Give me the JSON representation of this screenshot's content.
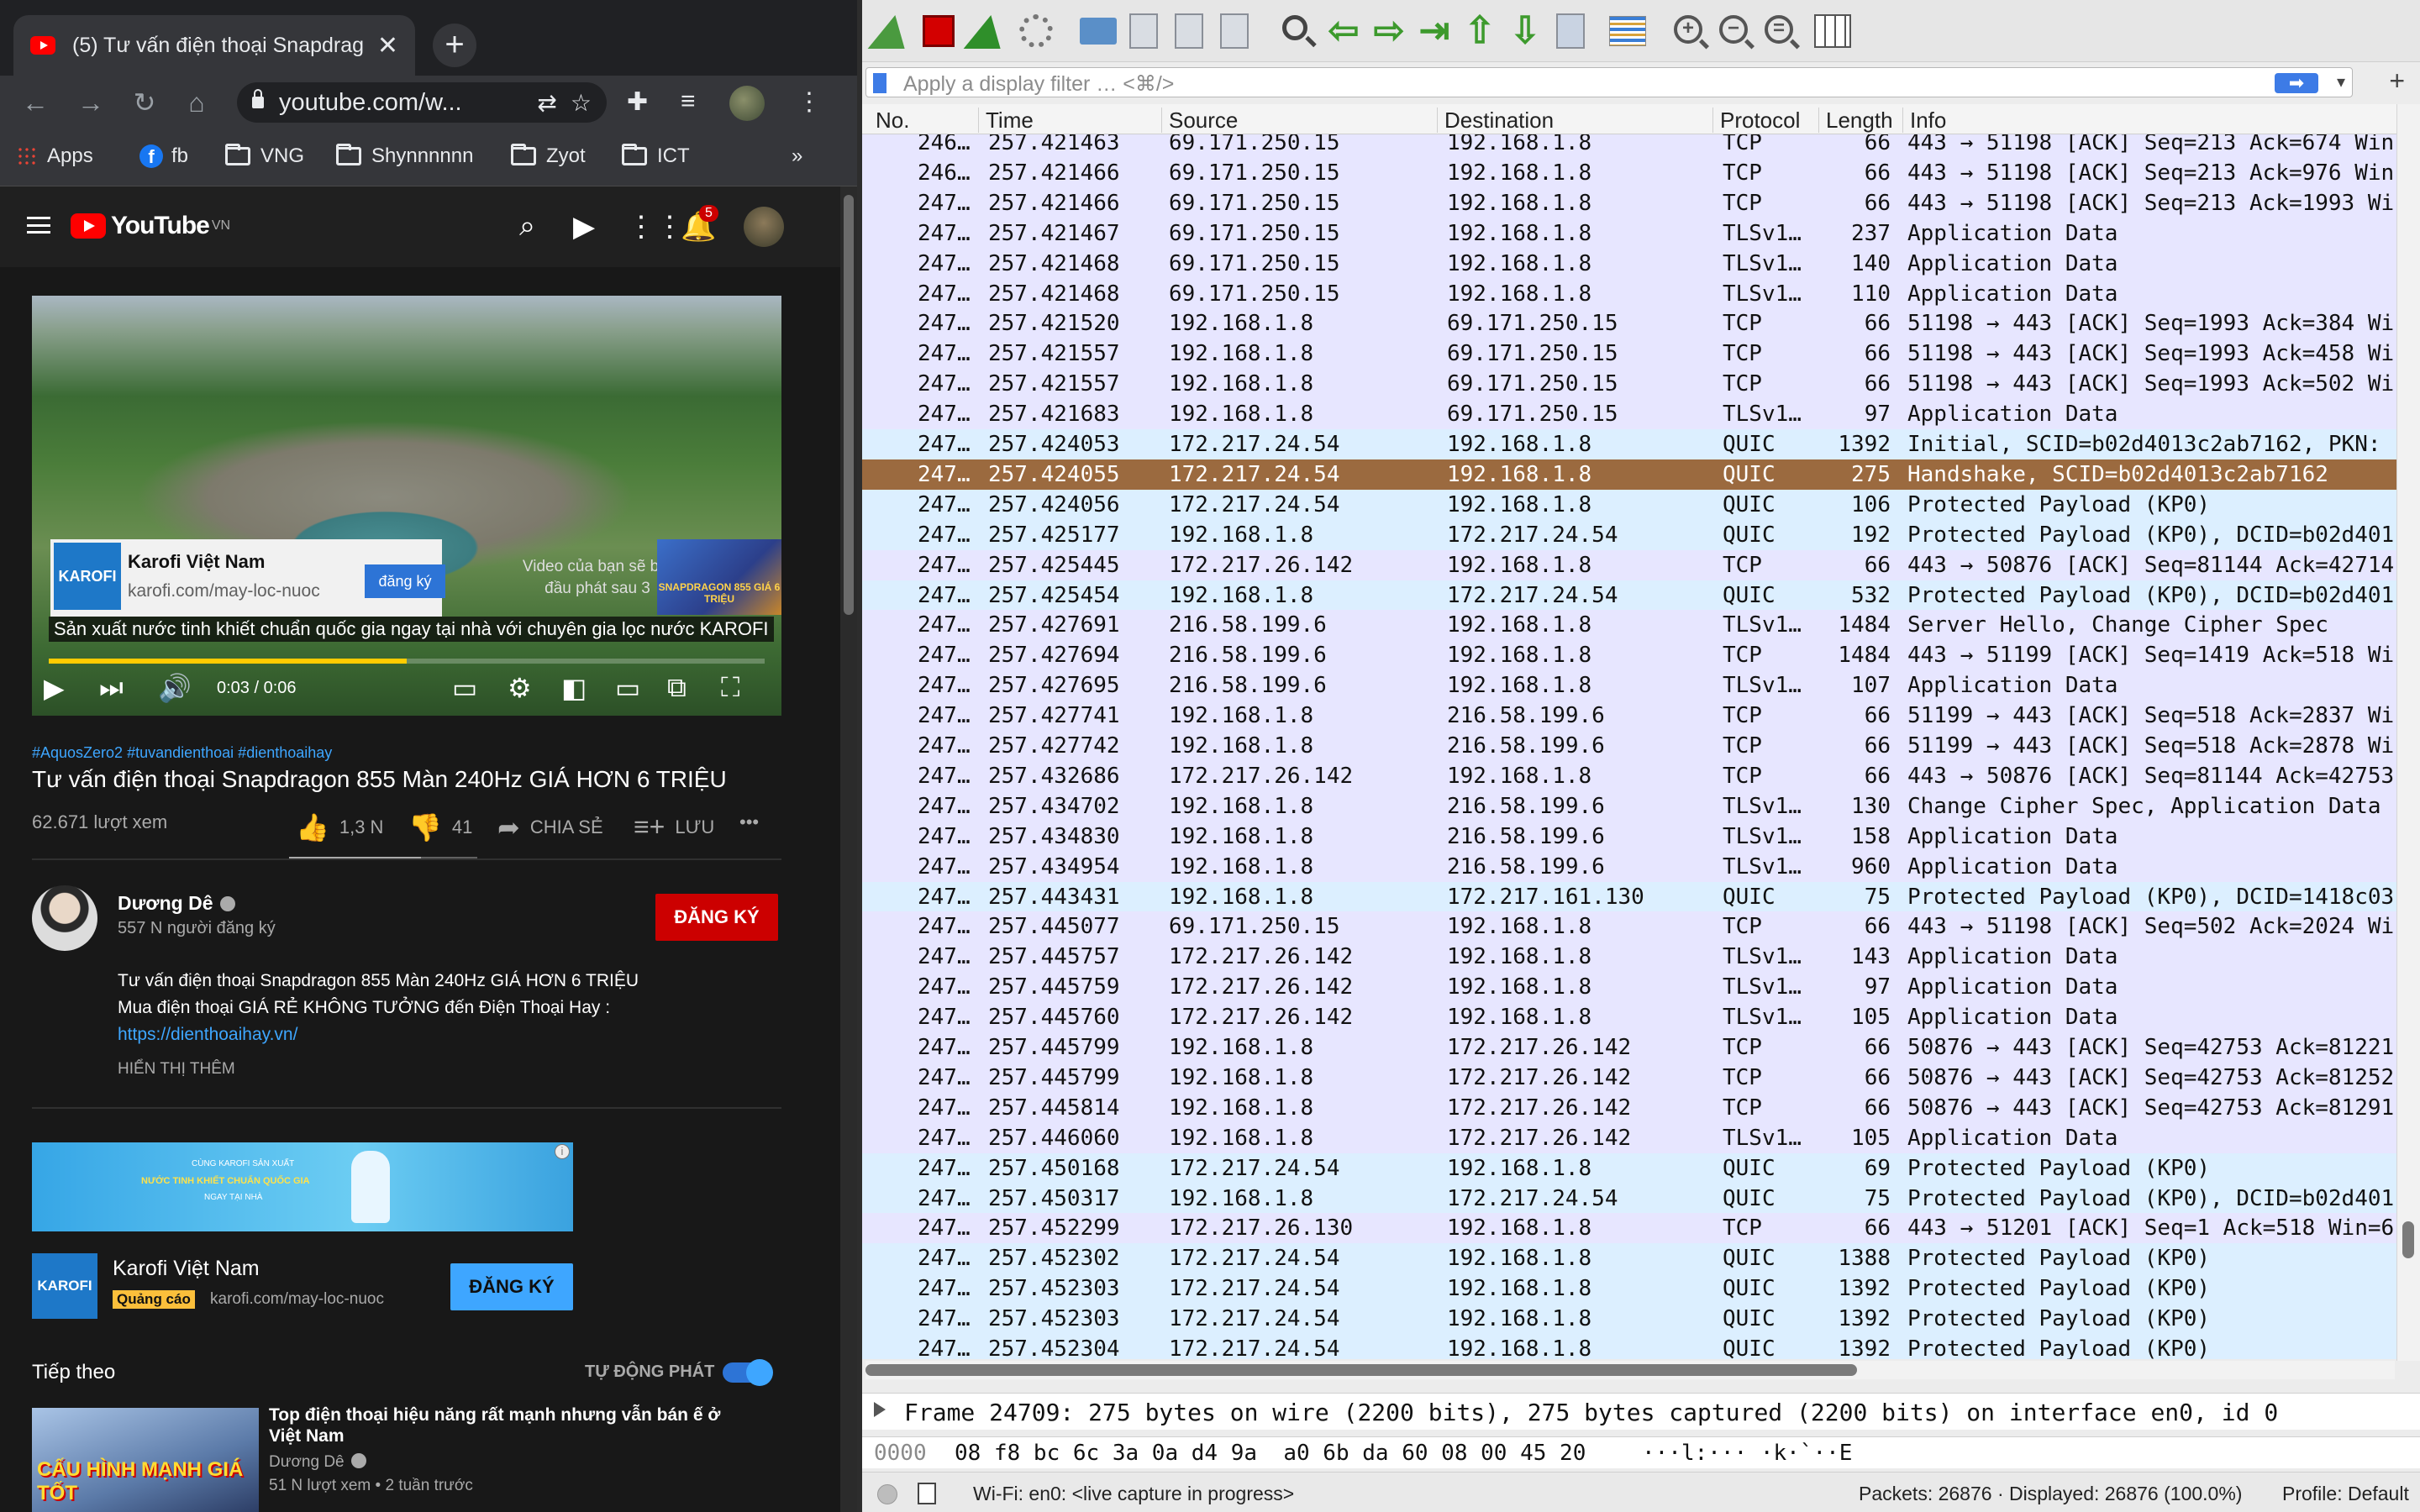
{
  "browser": {
    "tab_title": "(5) Tư vấn điện thoại Snapdrag",
    "tab_close": "✕",
    "new_tab": "+",
    "url": "youtube.com/w...",
    "bookmarks": [
      {
        "label": "Apps",
        "icon": "apps-icon"
      },
      {
        "label": "fb",
        "icon": "facebook-icon"
      },
      {
        "label": "VNG",
        "icon": "folder-icon"
      },
      {
        "label": "Shynnnnnn",
        "icon": "folder-icon"
      },
      {
        "label": "Zyot",
        "icon": "folder-icon"
      },
      {
        "label": "ICT",
        "icon": "folder-icon"
      }
    ],
    "bookmarks_overflow": "»"
  },
  "youtube": {
    "logo_text": "YouTube",
    "region": "VN",
    "notification_count": "5",
    "ad_card": {
      "logo": "KAROFI",
      "name": "Karofi Việt Nam",
      "url": "karofi.com/may-loc-nuoc",
      "button": "đăng ký"
    },
    "skip_note": "Video của bạn sẽ bắt đầu phát sau 3",
    "skip_thumb_text": "SNAPDRAGON 855 GIÁ 6 TRIỆU",
    "caption": "Sản xuất nước tinh khiết chuẩn quốc gia ngay tại nhà với chuyên gia lọc nước KAROFI",
    "timecode": "0:03 / 0:06",
    "progress_fraction": 0.5,
    "hashtags": "#AquosZero2 #tuvandienthoai #dienthoaihay",
    "video_title": "Tư vấn điện thoại Snapdragon 855 Màn 240Hz GIÁ HƠN 6 TRIỆU",
    "views": "62.671 lượt xem",
    "likes": "1,3 N",
    "dislikes": "41",
    "share_label": "CHIA SẺ",
    "save_label": "LƯU",
    "more": "•••",
    "like_ratio": 0.7,
    "channel": {
      "name": "Dương Dê",
      "subscribers": "557 N người đăng ký",
      "subscribe_button": "ĐĂNG KÝ"
    },
    "description": [
      "Tư vấn điện thoại Snapdragon 855 Màn 240Hz GIÁ HƠN 6 TRIỆU",
      "Mua điện thoại GIÁ RẺ KHÔNG TƯỞNG đến Điện Thoại Hay :"
    ],
    "description_link": "https://dienthoaihay.vn/",
    "show_more": "HIỂN THỊ THÊM",
    "banner": {
      "line1": "CÙNG KAROFI SẢN XUẤT",
      "line2": "NƯỚC TINH KHIẾT CHUẨN QUỐC GIA",
      "line3": "NGAY TẠI NHÀ",
      "info": "i"
    },
    "ad2": {
      "logo": "KAROFI",
      "name": "Karofi Việt Nam",
      "badge": "Quảng cáo",
      "url": "karofi.com/may-loc-nuoc",
      "button": "ĐĂNG KÝ"
    },
    "up_next": "Tiếp theo",
    "autoplay": "TỰ ĐỘNG PHÁT",
    "next_video": {
      "thumb_text": "CẤU HÌNH MẠNH GIÁ TỐT",
      "title": "Top điện thoại hiệu năng rất mạnh nhưng vẫn bán ế ở Việt Nam",
      "channel": "Dương Dê",
      "meta": "51 N lượt xem • 2 tuần trước"
    }
  },
  "wireshark": {
    "filter_placeholder": "Apply a display filter … <⌘/>",
    "columns": [
      "No.",
      "Time",
      "Source",
      "Destination",
      "Protocol",
      "Length",
      "Info"
    ],
    "packets": [
      {
        "no": "246…",
        "time": "257.421463",
        "src": "69.171.250.15",
        "dst": "192.168.1.8",
        "proto": "TCP",
        "len": "66",
        "info": "443 → 51198 [ACK] Seq=213 Ack=674 Win",
        "kind": "tcp"
      },
      {
        "no": "246…",
        "time": "257.421466",
        "src": "69.171.250.15",
        "dst": "192.168.1.8",
        "proto": "TCP",
        "len": "66",
        "info": "443 → 51198 [ACK] Seq=213 Ack=976 Win",
        "kind": "tcp"
      },
      {
        "no": "247…",
        "time": "257.421466",
        "src": "69.171.250.15",
        "dst": "192.168.1.8",
        "proto": "TCP",
        "len": "66",
        "info": "443 → 51198 [ACK] Seq=213 Ack=1993 Wi",
        "kind": "tcp"
      },
      {
        "no": "247…",
        "time": "257.421467",
        "src": "69.171.250.15",
        "dst": "192.168.1.8",
        "proto": "TLSv1…",
        "len": "237",
        "info": "Application Data",
        "kind": "tls"
      },
      {
        "no": "247…",
        "time": "257.421468",
        "src": "69.171.250.15",
        "dst": "192.168.1.8",
        "proto": "TLSv1…",
        "len": "140",
        "info": "Application Data",
        "kind": "tls"
      },
      {
        "no": "247…",
        "time": "257.421468",
        "src": "69.171.250.15",
        "dst": "192.168.1.8",
        "proto": "TLSv1…",
        "len": "110",
        "info": "Application Data",
        "kind": "tls"
      },
      {
        "no": "247…",
        "time": "257.421520",
        "src": "192.168.1.8",
        "dst": "69.171.250.15",
        "proto": "TCP",
        "len": "66",
        "info": "51198 → 443 [ACK] Seq=1993 Ack=384 Wi",
        "kind": "tcp"
      },
      {
        "no": "247…",
        "time": "257.421557",
        "src": "192.168.1.8",
        "dst": "69.171.250.15",
        "proto": "TCP",
        "len": "66",
        "info": "51198 → 443 [ACK] Seq=1993 Ack=458 Wi",
        "kind": "tcp"
      },
      {
        "no": "247…",
        "time": "257.421557",
        "src": "192.168.1.8",
        "dst": "69.171.250.15",
        "proto": "TCP",
        "len": "66",
        "info": "51198 → 443 [ACK] Seq=1993 Ack=502 Wi",
        "kind": "tcp"
      },
      {
        "no": "247…",
        "time": "257.421683",
        "src": "192.168.1.8",
        "dst": "69.171.250.15",
        "proto": "TLSv1…",
        "len": "97",
        "info": "Application Data",
        "kind": "tls"
      },
      {
        "no": "247…",
        "time": "257.424053",
        "src": "172.217.24.54",
        "dst": "192.168.1.8",
        "proto": "QUIC",
        "len": "1392",
        "info": "Initial, SCID=b02d4013c2ab7162, PKN:",
        "kind": "quic"
      },
      {
        "no": "247…",
        "time": "257.424055",
        "src": "172.217.24.54",
        "dst": "192.168.1.8",
        "proto": "QUIC",
        "len": "275",
        "info": "Handshake, SCID=b02d4013c2ab7162",
        "kind": "sel"
      },
      {
        "no": "247…",
        "time": "257.424056",
        "src": "172.217.24.54",
        "dst": "192.168.1.8",
        "proto": "QUIC",
        "len": "106",
        "info": "Protected Payload (KP0)",
        "kind": "quic"
      },
      {
        "no": "247…",
        "time": "257.425177",
        "src": "192.168.1.8",
        "dst": "172.217.24.54",
        "proto": "QUIC",
        "len": "192",
        "info": "Protected Payload (KP0), DCID=b02d401",
        "kind": "quic"
      },
      {
        "no": "247…",
        "time": "257.425445",
        "src": "172.217.26.142",
        "dst": "192.168.1.8",
        "proto": "TCP",
        "len": "66",
        "info": "443 → 50876 [ACK] Seq=81144 Ack=42714",
        "kind": "tcp"
      },
      {
        "no": "247…",
        "time": "257.425454",
        "src": "192.168.1.8",
        "dst": "172.217.24.54",
        "proto": "QUIC",
        "len": "532",
        "info": "Protected Payload (KP0), DCID=b02d401",
        "kind": "quic"
      },
      {
        "no": "247…",
        "time": "257.427691",
        "src": "216.58.199.6",
        "dst": "192.168.1.8",
        "proto": "TLSv1…",
        "len": "1484",
        "info": "Server Hello, Change Cipher Spec",
        "kind": "tls"
      },
      {
        "no": "247…",
        "time": "257.427694",
        "src": "216.58.199.6",
        "dst": "192.168.1.8",
        "proto": "TCP",
        "len": "1484",
        "info": "443 → 51199 [ACK] Seq=1419 Ack=518 Wi",
        "kind": "tcp"
      },
      {
        "no": "247…",
        "time": "257.427695",
        "src": "216.58.199.6",
        "dst": "192.168.1.8",
        "proto": "TLSv1…",
        "len": "107",
        "info": "Application Data",
        "kind": "tls"
      },
      {
        "no": "247…",
        "time": "257.427741",
        "src": "192.168.1.8",
        "dst": "216.58.199.6",
        "proto": "TCP",
        "len": "66",
        "info": "51199 → 443 [ACK] Seq=518 Ack=2837 Wi",
        "kind": "tcp"
      },
      {
        "no": "247…",
        "time": "257.427742",
        "src": "192.168.1.8",
        "dst": "216.58.199.6",
        "proto": "TCP",
        "len": "66",
        "info": "51199 → 443 [ACK] Seq=518 Ack=2878 Wi",
        "kind": "tcp"
      },
      {
        "no": "247…",
        "time": "257.432686",
        "src": "172.217.26.142",
        "dst": "192.168.1.8",
        "proto": "TCP",
        "len": "66",
        "info": "443 → 50876 [ACK] Seq=81144 Ack=42753",
        "kind": "tcp"
      },
      {
        "no": "247…",
        "time": "257.434702",
        "src": "192.168.1.8",
        "dst": "216.58.199.6",
        "proto": "TLSv1…",
        "len": "130",
        "info": "Change Cipher Spec, Application Data",
        "kind": "tls"
      },
      {
        "no": "247…",
        "time": "257.434830",
        "src": "192.168.1.8",
        "dst": "216.58.199.6",
        "proto": "TLSv1…",
        "len": "158",
        "info": "Application Data",
        "kind": "tls"
      },
      {
        "no": "247…",
        "time": "257.434954",
        "src": "192.168.1.8",
        "dst": "216.58.199.6",
        "proto": "TLSv1…",
        "len": "960",
        "info": "Application Data",
        "kind": "tls"
      },
      {
        "no": "247…",
        "time": "257.443431",
        "src": "192.168.1.8",
        "dst": "172.217.161.130",
        "proto": "QUIC",
        "len": "75",
        "info": "Protected Payload (KP0), DCID=1418c03",
        "kind": "quic"
      },
      {
        "no": "247…",
        "time": "257.445077",
        "src": "69.171.250.15",
        "dst": "192.168.1.8",
        "proto": "TCP",
        "len": "66",
        "info": "443 → 51198 [ACK] Seq=502 Ack=2024 Wi",
        "kind": "tcp"
      },
      {
        "no": "247…",
        "time": "257.445757",
        "src": "172.217.26.142",
        "dst": "192.168.1.8",
        "proto": "TLSv1…",
        "len": "143",
        "info": "Application Data",
        "kind": "tls"
      },
      {
        "no": "247…",
        "time": "257.445759",
        "src": "172.217.26.142",
        "dst": "192.168.1.8",
        "proto": "TLSv1…",
        "len": "97",
        "info": "Application Data",
        "kind": "tls"
      },
      {
        "no": "247…",
        "time": "257.445760",
        "src": "172.217.26.142",
        "dst": "192.168.1.8",
        "proto": "TLSv1…",
        "len": "105",
        "info": "Application Data",
        "kind": "tls"
      },
      {
        "no": "247…",
        "time": "257.445799",
        "src": "192.168.1.8",
        "dst": "172.217.26.142",
        "proto": "TCP",
        "len": "66",
        "info": "50876 → 443 [ACK] Seq=42753 Ack=81221",
        "kind": "tcp"
      },
      {
        "no": "247…",
        "time": "257.445799",
        "src": "192.168.1.8",
        "dst": "172.217.26.142",
        "proto": "TCP",
        "len": "66",
        "info": "50876 → 443 [ACK] Seq=42753 Ack=81252",
        "kind": "tcp"
      },
      {
        "no": "247…",
        "time": "257.445814",
        "src": "192.168.1.8",
        "dst": "172.217.26.142",
        "proto": "TCP",
        "len": "66",
        "info": "50876 → 443 [ACK] Seq=42753 Ack=81291",
        "kind": "tcp"
      },
      {
        "no": "247…",
        "time": "257.446060",
        "src": "192.168.1.8",
        "dst": "172.217.26.142",
        "proto": "TLSv1…",
        "len": "105",
        "info": "Application Data",
        "kind": "tls"
      },
      {
        "no": "247…",
        "time": "257.450168",
        "src": "172.217.24.54",
        "dst": "192.168.1.8",
        "proto": "QUIC",
        "len": "69",
        "info": "Protected Payload (KP0)",
        "kind": "quic"
      },
      {
        "no": "247…",
        "time": "257.450317",
        "src": "192.168.1.8",
        "dst": "172.217.24.54",
        "proto": "QUIC",
        "len": "75",
        "info": "Protected Payload (KP0), DCID=b02d401",
        "kind": "quic"
      },
      {
        "no": "247…",
        "time": "257.452299",
        "src": "172.217.26.130",
        "dst": "192.168.1.8",
        "proto": "TCP",
        "len": "66",
        "info": "443 → 51201 [ACK] Seq=1 Ack=518 Win=6",
        "kind": "tcp"
      },
      {
        "no": "247…",
        "time": "257.452302",
        "src": "172.217.24.54",
        "dst": "192.168.1.8",
        "proto": "QUIC",
        "len": "1388",
        "info": "Protected Payload (KP0)",
        "kind": "quic"
      },
      {
        "no": "247…",
        "time": "257.452303",
        "src": "172.217.24.54",
        "dst": "192.168.1.8",
        "proto": "QUIC",
        "len": "1392",
        "info": "Protected Payload (KP0)",
        "kind": "quic"
      },
      {
        "no": "247…",
        "time": "257.452303",
        "src": "172.217.24.54",
        "dst": "192.168.1.8",
        "proto": "QUIC",
        "len": "1392",
        "info": "Protected Payload (KP0)",
        "kind": "quic"
      },
      {
        "no": "247…",
        "time": "257.452304",
        "src": "172.217.24.54",
        "dst": "192.168.1.8",
        "proto": "QUIC",
        "len": "1392",
        "info": "Protected Payload (KP0)",
        "kind": "quic"
      }
    ],
    "detail": "Frame 24709: 275 bytes on wire (2200 bits), 275 bytes captured (2200 bits) on interface en0, id 0",
    "bytes_offset": "0000",
    "bytes_hex": "08 f8 bc 6c 3a 0a d4 9a  a0 6b da 60 08 00 45 20",
    "bytes_ascii": "···l:··· ·k·`··E",
    "status": {
      "interface": "Wi-Fi: en0: <live capture in progress>",
      "packets": "Packets: 26876 · Displayed: 26876 (100.0%)",
      "profile": "Profile: Default"
    },
    "colors": {
      "tcp_row": "#e7e6ff",
      "quic_row": "#dcefff",
      "selected_row": "#9b6a3f"
    }
  }
}
